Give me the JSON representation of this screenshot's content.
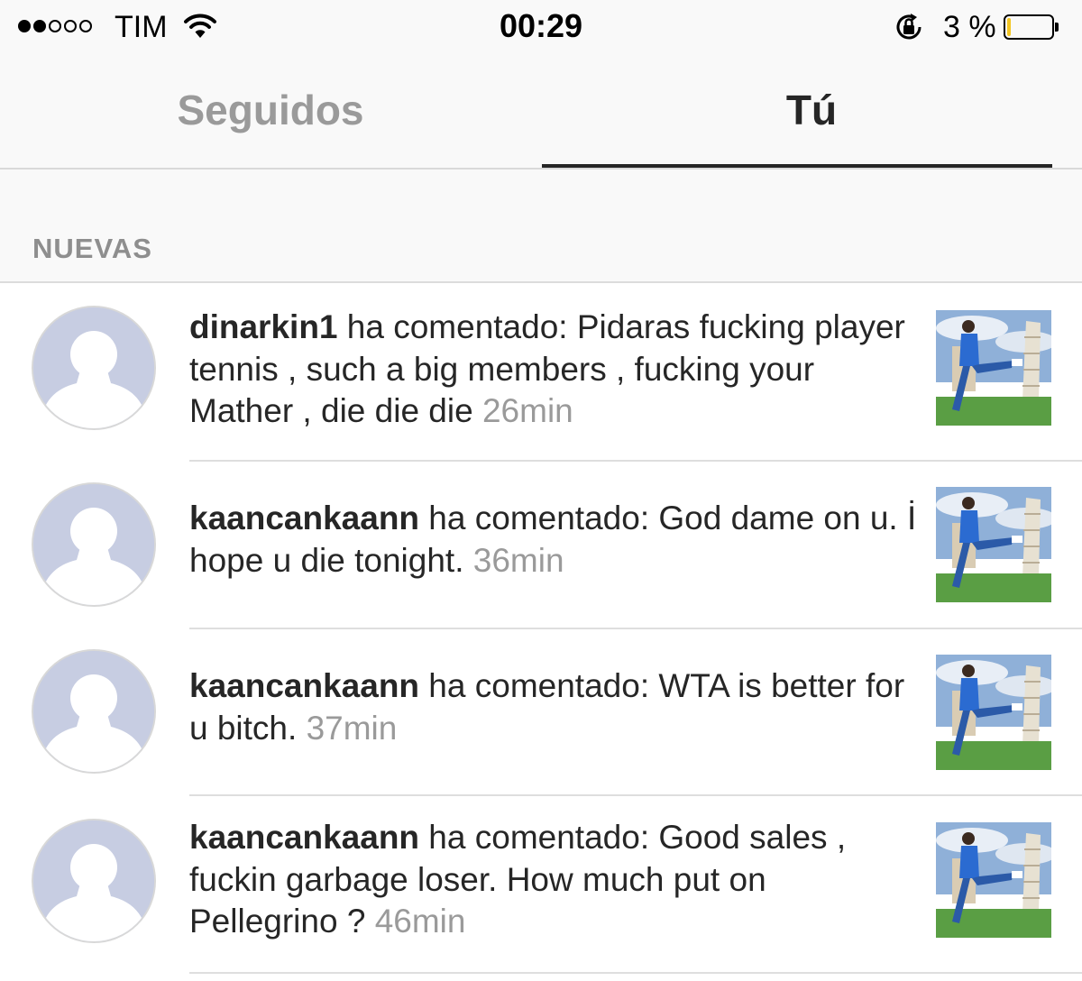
{
  "status_bar": {
    "carrier": "TIM",
    "time": "00:29",
    "battery_percent": "3 %",
    "battery_level": 0.03,
    "signal_strength": 2,
    "signal_max": 5,
    "icons": [
      "wifi-icon",
      "rotation-lock-icon",
      "battery-icon"
    ]
  },
  "tabs": [
    {
      "label": "Seguidos",
      "active": false
    },
    {
      "label": "Tú",
      "active": true
    }
  ],
  "section": {
    "title": "NUEVAS"
  },
  "notifications": [
    {
      "username": "dinarkin1",
      "action": " ha comentado: ",
      "comment": "Pidaras fucking player tennis , such a big members , fucking your Mather , die die die",
      "time": "26min"
    },
    {
      "username": "kaancankaann",
      "action": " ha comentado: ",
      "comment": "God dame on u. İ hope u die  tonight.",
      "time": "36min"
    },
    {
      "username": "kaancankaann",
      "action": " ha comentado: ",
      "comment": "WTA is better for u bitch.",
      "time": "37min"
    },
    {
      "username": "kaancankaann",
      "action": " ha comentado: ",
      "comment": "Good sales , fuckin garbage loser. How much put on Pellegrino ?",
      "time": "46min"
    }
  ],
  "colors": {
    "background_bar": "#f9f9f9",
    "avatar_placeholder": "#c7cde2",
    "text_primary": "#262626",
    "text_secondary": "#9a9a9a",
    "battery_low": "#f3c623"
  }
}
